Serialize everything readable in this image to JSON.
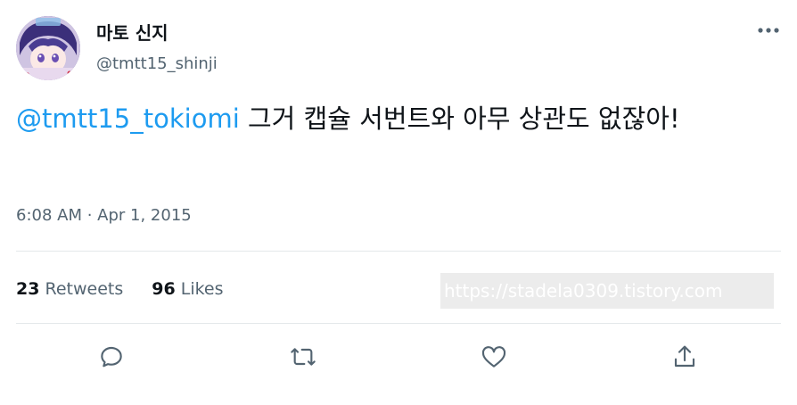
{
  "user": {
    "display_name": "마토 신지",
    "handle": "@tmtt15_shinji",
    "avatar_icon": "profile-avatar"
  },
  "tweet": {
    "mention": "@tmtt15_tokiomi",
    "text": " 그거 캡슐 서번트와 아무 상관도 없잖아!",
    "time": "6:08 AM",
    "separator": " · ",
    "date": "Apr 1, 2015"
  },
  "stats": {
    "retweets_count": "23",
    "retweets_label": " Retweets",
    "likes_count": "96",
    "likes_label": " Likes"
  },
  "watermark": "https://stadela0309.tistory.com",
  "actions": {
    "reply_icon": "reply-icon",
    "retweet_icon": "retweet-icon",
    "like_icon": "heart-icon",
    "share_icon": "share-icon",
    "more_icon": "more-options-icon"
  },
  "colors": {
    "mention": "#1d9bf0",
    "secondary_text": "#536471",
    "primary_text": "#0f1419",
    "divider": "#e4e8ea"
  }
}
